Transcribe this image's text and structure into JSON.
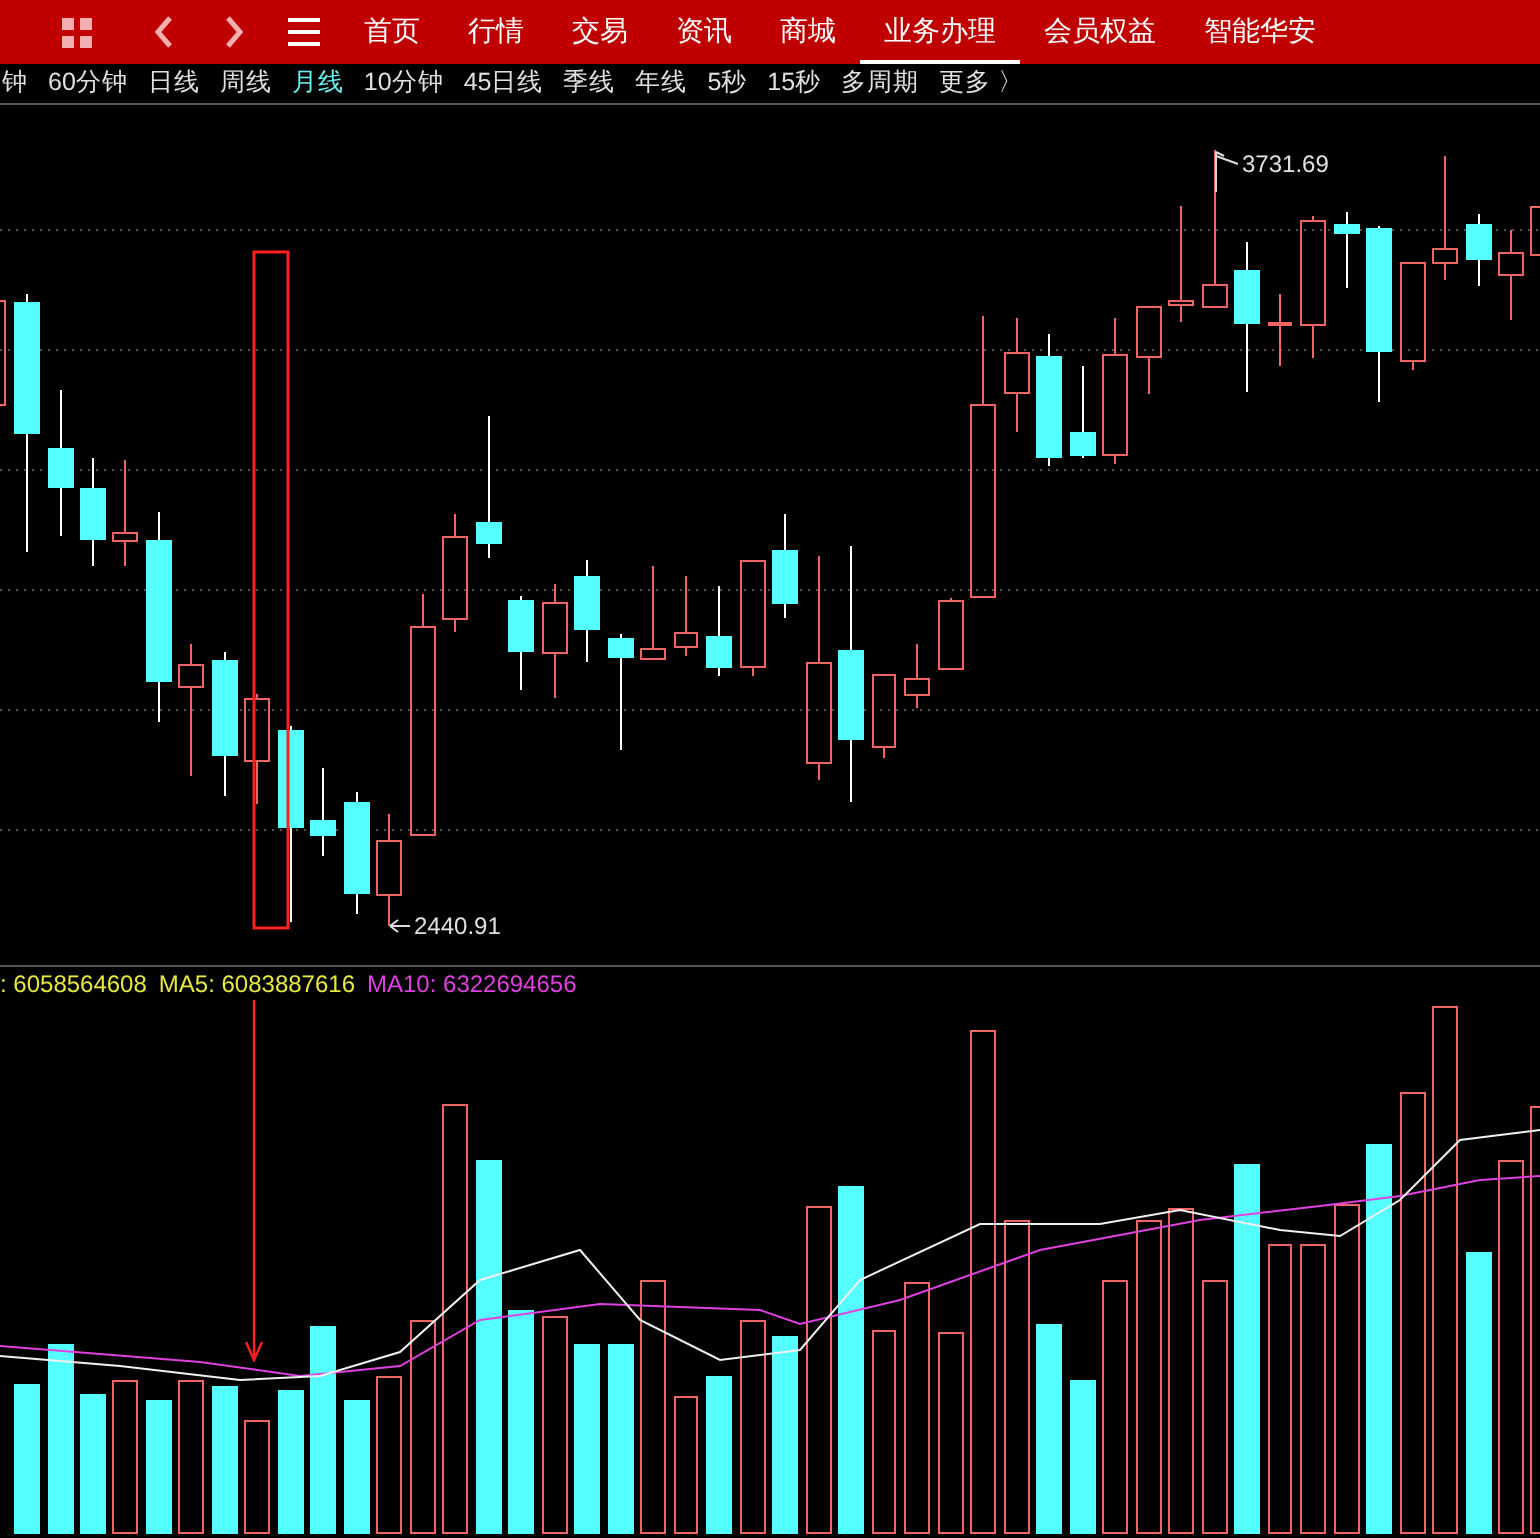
{
  "nav": {
    "tabs": [
      {
        "label": "首页",
        "selected": false
      },
      {
        "label": "行情",
        "selected": false
      },
      {
        "label": "交易",
        "selected": false
      },
      {
        "label": "资讯",
        "selected": false
      },
      {
        "label": "商城",
        "selected": false
      },
      {
        "label": "业务办理",
        "selected": true
      },
      {
        "label": "会员权益",
        "selected": false
      },
      {
        "label": "智能华安",
        "selected": false
      }
    ]
  },
  "periods": [
    {
      "label": "钟",
      "selected": false
    },
    {
      "label": "60分钟",
      "selected": false
    },
    {
      "label": "日线",
      "selected": false
    },
    {
      "label": "周线",
      "selected": false
    },
    {
      "label": "月线",
      "selected": true
    },
    {
      "label": "10分钟",
      "selected": false
    },
    {
      "label": "45日线",
      "selected": false
    },
    {
      "label": "季线",
      "selected": false
    },
    {
      "label": "年线",
      "selected": false
    },
    {
      "label": "5秒",
      "selected": false
    },
    {
      "label": "15秒",
      "selected": false
    },
    {
      "label": "多周期",
      "selected": false
    },
    {
      "label": "更多 〉",
      "selected": false
    }
  ],
  "price_chart": {
    "high_label": "3731.69",
    "low_label": "2440.91"
  },
  "volume_legend": [
    {
      "text": ": 6058564608",
      "color": "#e8e840"
    },
    {
      "text": "MA5: 6083887616",
      "color": "#e8e840"
    },
    {
      "text": "MA10: 6322694656",
      "color": "#e040e0"
    }
  ]
}
